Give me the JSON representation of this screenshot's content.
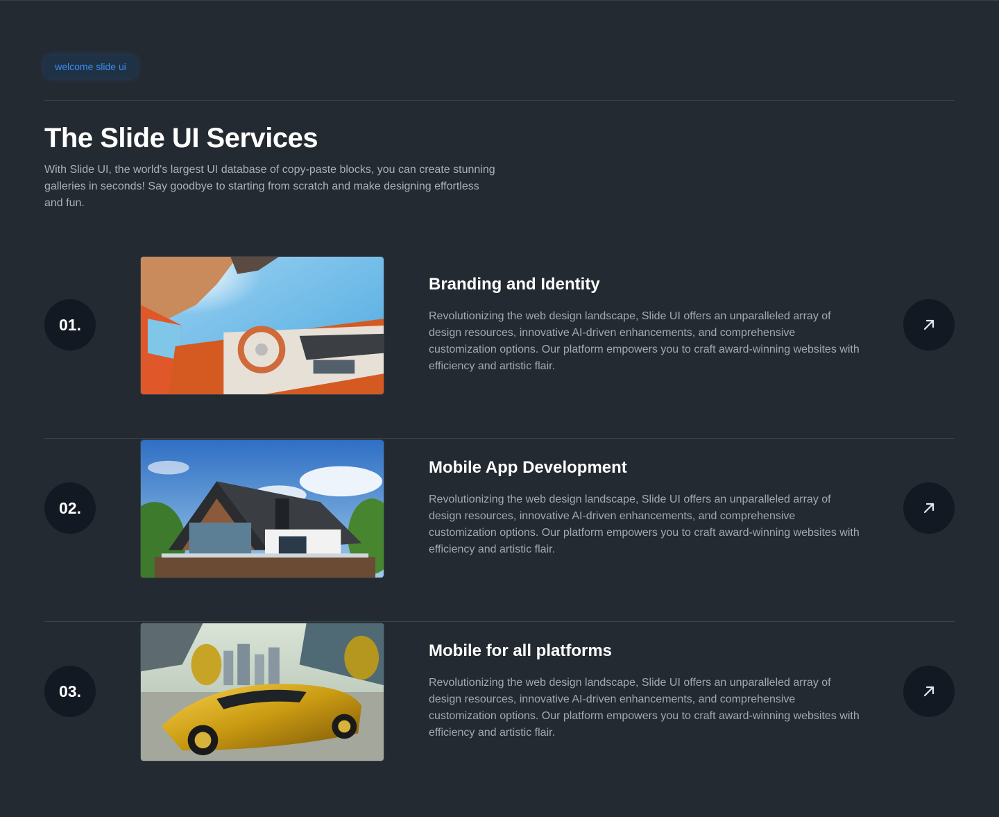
{
  "header": {
    "badge": "welcome slide ui",
    "title": "The Slide UI Services",
    "intro": "With Slide UI, the world's largest UI database of copy-paste blocks, you can create stunning galleries in seconds! Say goodbye to starting from scratch and make designing effortless and fun."
  },
  "services": [
    {
      "number": "01.",
      "title": "Branding and Identity",
      "description": "Revolutionizing the web design landscape, Slide UI offers an unparalleled array of design resources, innovative AI-driven enhancements, and comprehensive customization options. Our platform empowers you to craft award-winning websites with efficiency and artistic flair.",
      "image_icon": "car-interior-image",
      "arrow_icon": "arrow-up-right-icon"
    },
    {
      "number": "02.",
      "title": "Mobile App Development",
      "description": "Revolutionizing the web design landscape, Slide UI offers an unparalleled array of design resources, innovative AI-driven enhancements, and comprehensive customization options. Our platform empowers you to craft award-winning websites with efficiency and artistic flair.",
      "image_icon": "modern-house-image",
      "arrow_icon": "arrow-up-right-icon"
    },
    {
      "number": "03.",
      "title": "Mobile for all platforms",
      "description": "Revolutionizing the web design landscape, Slide UI offers an unparalleled array of design resources, innovative AI-driven enhancements, and comprehensive customization options. Our platform empowers you to craft award-winning websites with efficiency and artistic flair.",
      "image_icon": "gold-sports-car-image",
      "arrow_icon": "arrow-up-right-icon"
    }
  ],
  "colors": {
    "background": "#242a31",
    "accent": "#3b8cf0",
    "circle": "#131922",
    "muted_text": "#a2a9b1"
  }
}
